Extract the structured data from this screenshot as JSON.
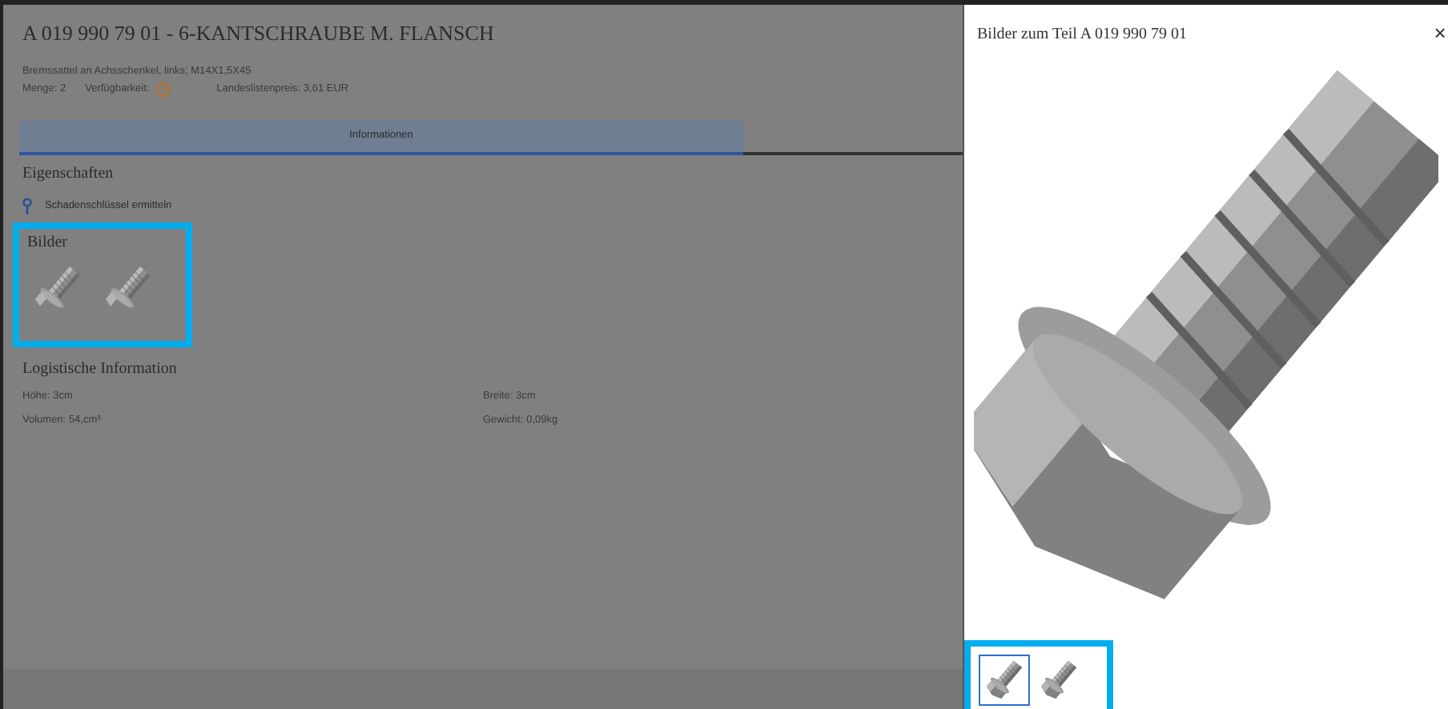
{
  "part_panel": {
    "title": "A 019 990 79 01 - 6-KANTSCHRAUBE M. FLANSCH",
    "description": "Bremssattel an Achsschenkel, links; M14X1,5X45",
    "quantity": "Menge: 2",
    "availability_label": "Verfügbarkeit:",
    "price": "Landeslistenpreis: 3,61 EUR",
    "tabs": [
      {
        "label": "Informationen",
        "selected": true
      }
    ],
    "properties_heading": "Eigenschaften",
    "damage_key_link": "Schadenschlüssel ermitteln",
    "images_heading": "Bilder",
    "logistics_heading": "Logistische Information",
    "logistics": [
      [
        "Höhe: 3cm",
        "Breite: 3cm"
      ],
      [
        "Volumen: 54,cm³",
        "Gewicht: 0,09kg"
      ]
    ]
  },
  "image_viewer": {
    "title": "Bilder zum Teil A 019 990 79 01",
    "close": "×",
    "thumbnails": [
      {
        "selected": true
      },
      {
        "selected": false
      }
    ]
  }
}
